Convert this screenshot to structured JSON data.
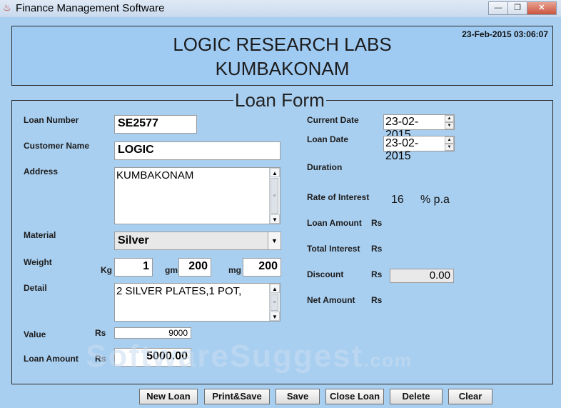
{
  "window": {
    "title": "Finance Management Software",
    "min_label": "—",
    "max_label": "❐",
    "close_label": "✕"
  },
  "header": {
    "line1": "LOGIC RESEARCH LABS",
    "line2": "KUMBAKONAM",
    "datetime": "23-Feb-2015 03:06:07"
  },
  "form": {
    "legend": "Loan Form",
    "loan_number": {
      "label": "Loan Number",
      "value": "SE2577"
    },
    "customer_name": {
      "label": "Customer Name",
      "value": "LOGIC"
    },
    "address": {
      "label": "Address",
      "value": "KUMBAKONAM"
    },
    "material": {
      "label": "Material",
      "value": "Silver"
    },
    "weight": {
      "label": "Weight",
      "kg_label": "Kg",
      "kg_value": "1",
      "gm_label": "gm",
      "gm_value": "200",
      "mg_label": "mg",
      "mg_value": "200"
    },
    "detail": {
      "label": "Detail",
      "value": "2 SILVER PLATES,1 POT,"
    },
    "value": {
      "label": "Value",
      "currency": "Rs",
      "amount": "9000"
    },
    "loan_amount_left": {
      "label": "Loan Amount",
      "currency": "Rs",
      "amount": "5000.00"
    },
    "current_date": {
      "label": "Current Date",
      "value": "23-02-2015"
    },
    "loan_date": {
      "label": "Loan Date",
      "value": "23-02-2015"
    },
    "duration": {
      "label": "Duration"
    },
    "rate_of_interest": {
      "label": "Rate of Interest",
      "value": "16",
      "unit": "% p.a"
    },
    "loan_amount_right": {
      "label": "Loan Amount",
      "currency": "Rs"
    },
    "total_interest": {
      "label": "Total Interest",
      "currency": "Rs"
    },
    "discount": {
      "label": "Discount",
      "currency": "Rs",
      "value": "0.00"
    },
    "net_amount": {
      "label": "Net Amount",
      "currency": "Rs"
    }
  },
  "buttons": {
    "new_loan": "New Loan",
    "print_save": "Print&Save",
    "save": "Save",
    "close_loan": "Close Loan",
    "delete": "Delete",
    "clear": "Clear"
  },
  "watermark": {
    "main": "SoftwareSuggest",
    "suffix": ".com"
  }
}
